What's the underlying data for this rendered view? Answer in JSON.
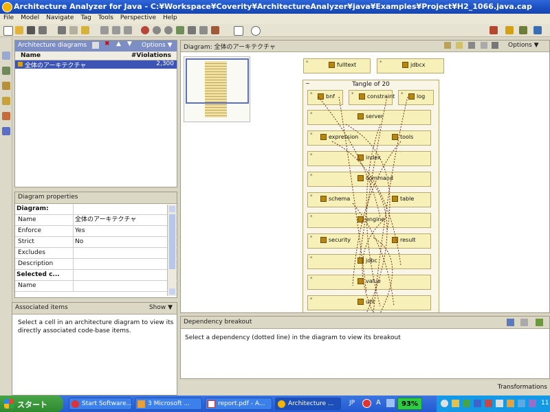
{
  "window": {
    "title": "Architecture Analyzer for Java - C:¥Workspace¥Coverity¥ArchitectureAnalyzer¥java¥Examples¥Project¥H2_1066.java.cap"
  },
  "menu": [
    "File",
    "Model",
    "Navigate",
    "Tag",
    "Tools",
    "Perspective",
    "Help"
  ],
  "diagrams_panel": {
    "title": "Architecture diagrams",
    "options_label": "Options",
    "col_name": "Name",
    "col_violations": "#Violations",
    "rows": [
      {
        "name": "全体のアーキテクチャ",
        "violations": "2,300"
      }
    ]
  },
  "properties_panel": {
    "title": "Diagram properties",
    "rows": [
      {
        "label": "Diagram:",
        "value": "",
        "section": true
      },
      {
        "label": "Name",
        "value": "全体のアーキテクチャ",
        "section": false
      },
      {
        "label": "Enforce",
        "value": "Yes",
        "section": false
      },
      {
        "label": "Strict",
        "value": "No",
        "section": false
      },
      {
        "label": "Excludes",
        "value": "",
        "section": false
      },
      {
        "label": "Description",
        "value": "",
        "section": false
      },
      {
        "label": "Selected c...",
        "value": "",
        "section": true
      },
      {
        "label": "Name",
        "value": "",
        "section": false
      }
    ]
  },
  "associated_panel": {
    "title": "Associated items",
    "show_label": "Show",
    "message": "Select a cell in an architecture diagram to view its directly associated code-base items."
  },
  "diagram_view": {
    "title": "Diagram: 全体のアーキテクチャ",
    "options_label": "Options",
    "top_boxes": [
      {
        "label": "fulltext"
      },
      {
        "label": "jdbcx"
      }
    ],
    "tangle_title": "Tangle of 20",
    "tangle_top_row": [
      {
        "label": "bnf"
      },
      {
        "label": "constraint"
      },
      {
        "label": "log"
      }
    ],
    "rows": [
      {
        "items": [
          "server"
        ]
      },
      {
        "items": [
          "expression",
          "tools"
        ]
      },
      {
        "items": [
          "index"
        ]
      },
      {
        "items": [
          "command"
        ]
      },
      {
        "items": [
          "schema",
          "table"
        ]
      },
      {
        "items": [
          "engine"
        ]
      },
      {
        "items": [
          "security",
          "result"
        ]
      },
      {
        "items": [
          "jdbc"
        ]
      },
      {
        "items": [
          "value"
        ]
      },
      {
        "items": [
          "util"
        ]
      }
    ]
  },
  "dependency_panel": {
    "title": "Dependency breakout",
    "message": "Select a dependency (dotted line) in the diagram to view its breakout"
  },
  "status": {
    "text": "Transformations"
  },
  "taskbar": {
    "start_label": "スタート",
    "tasks": [
      {
        "label": "Start Software..."
      },
      {
        "label": "3 Microsoft ..."
      },
      {
        "label": "report.pdf - A..."
      },
      {
        "label": "Architecture ..."
      }
    ],
    "lang": "JP",
    "battery": "93%",
    "clock": "11"
  },
  "colors": {
    "accent": "#7d8ec4",
    "box_fill": "#f7f0b8",
    "dependency": "#6b2d1a",
    "taskbar": "#245ad2"
  }
}
